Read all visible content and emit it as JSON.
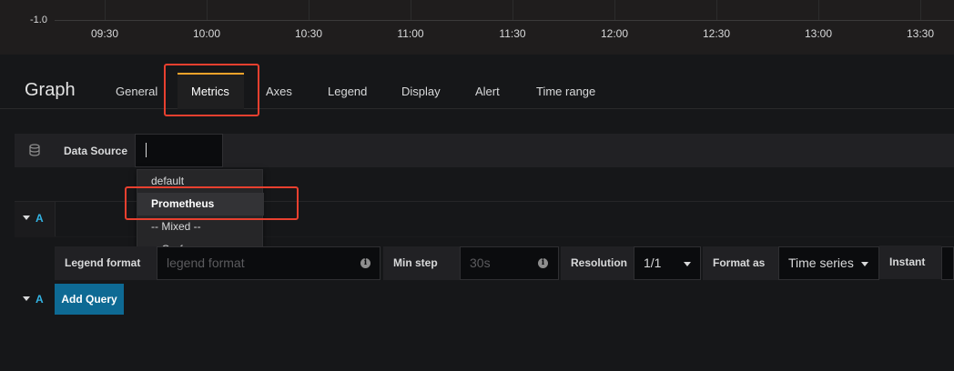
{
  "graph": {
    "y_tick": "-1.0",
    "x_ticks": [
      "09:30",
      "10:00",
      "10:30",
      "11:00",
      "11:30",
      "12:00",
      "12:30",
      "13:00",
      "13:30"
    ]
  },
  "editor": {
    "panel_title": "Graph",
    "tabs": [
      {
        "label": "General"
      },
      {
        "label": "Metrics",
        "active": true
      },
      {
        "label": "Axes"
      },
      {
        "label": "Legend"
      },
      {
        "label": "Display"
      },
      {
        "label": "Alert"
      },
      {
        "label": "Time range"
      }
    ],
    "active_tab_color": "#f7a32a",
    "highlight_color": "#e8402f"
  },
  "data_source": {
    "icon": "database-icon",
    "label": "Data Source",
    "value": "",
    "menu": [
      "default",
      "Prometheus",
      "-- Mixed --",
      "-- Grafana --"
    ],
    "highlighted": "Prometheus"
  },
  "query": {
    "row_letter": "A",
    "add_row_letter": "A",
    "legend_format_label": "Legend format",
    "legend_format_placeholder": "legend format",
    "min_step_label": "Min step",
    "min_step_placeholder": "30s",
    "resolution_label": "Resolution",
    "resolution_value": "1/1",
    "format_as_label": "Format as",
    "format_as_value": "Time series",
    "instant_label": "Instant",
    "add_query_label": "Add Query",
    "accent_color": "#33b5e5",
    "button_color": "#0e6a94"
  }
}
